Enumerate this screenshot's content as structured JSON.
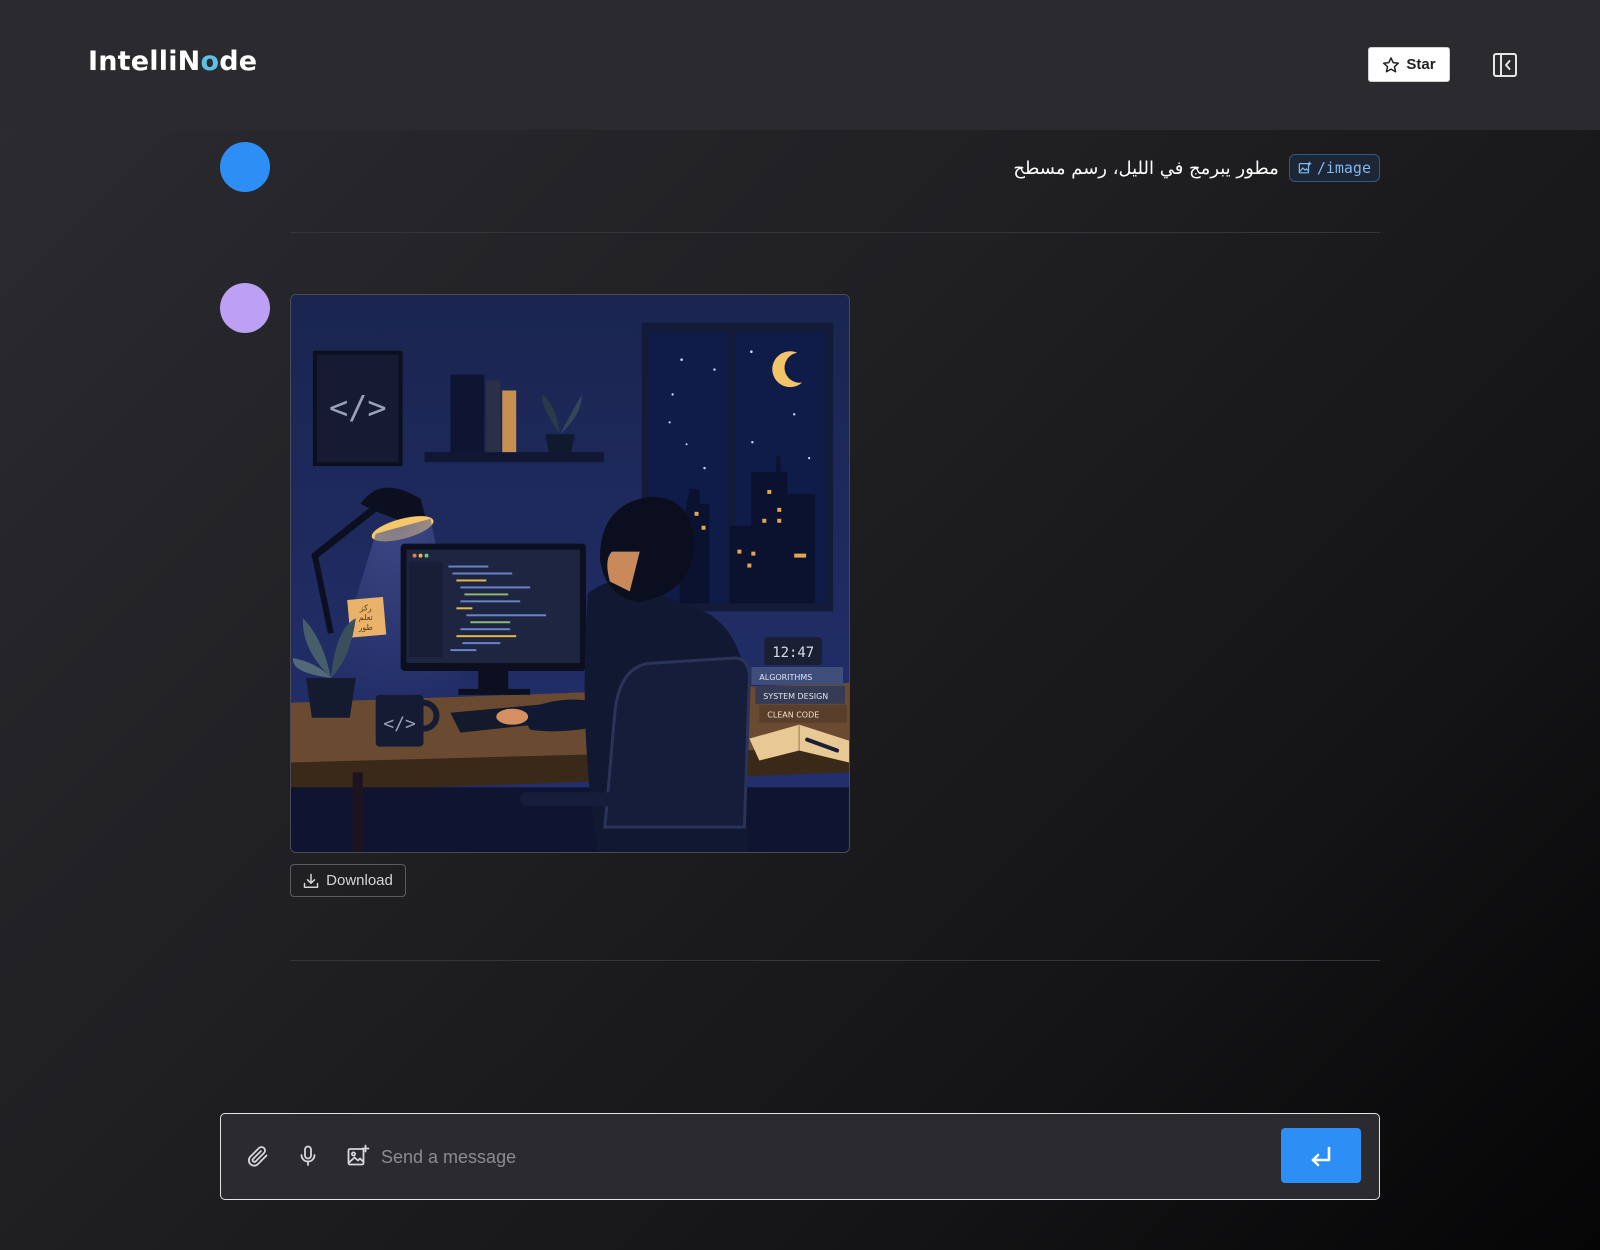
{
  "header": {
    "logo_prefix": "IntelliN",
    "logo_o": "o",
    "logo_suffix": "de",
    "star_label": "Star",
    "star_icon": "star-icon",
    "sidebar_toggle_icon": "sidebar-collapse-icon"
  },
  "conversation": {
    "user_message": {
      "command": "/image",
      "command_icon": "image-plus-icon",
      "text": "مطور يبرمج في الليل، رسم مسطح",
      "avatar_color": "#2d8ff5"
    },
    "bot_message": {
      "avatar_color": "#bba0f4",
      "image": {
        "clock": "12:47",
        "books": [
          "ALGORITHMS",
          "SYSTEM DESIGN",
          "CLEAN CODE"
        ],
        "sticky_note": [
          "ركز",
          "تعلم",
          "طور"
        ],
        "frame_symbol": "</>",
        "mug_symbol": "</>"
      },
      "download_label": "Download",
      "download_icon": "download-icon"
    }
  },
  "composer": {
    "placeholder": "Send a message",
    "value": "",
    "attach_icon": "paperclip-icon",
    "mic_icon": "microphone-icon",
    "image_icon": "image-plus-icon",
    "send_icon": "enter-icon"
  },
  "colors": {
    "accent": "#2d8ff5",
    "bot_avatar": "#bba0f4",
    "logo_accent": "#5ec0e6"
  }
}
